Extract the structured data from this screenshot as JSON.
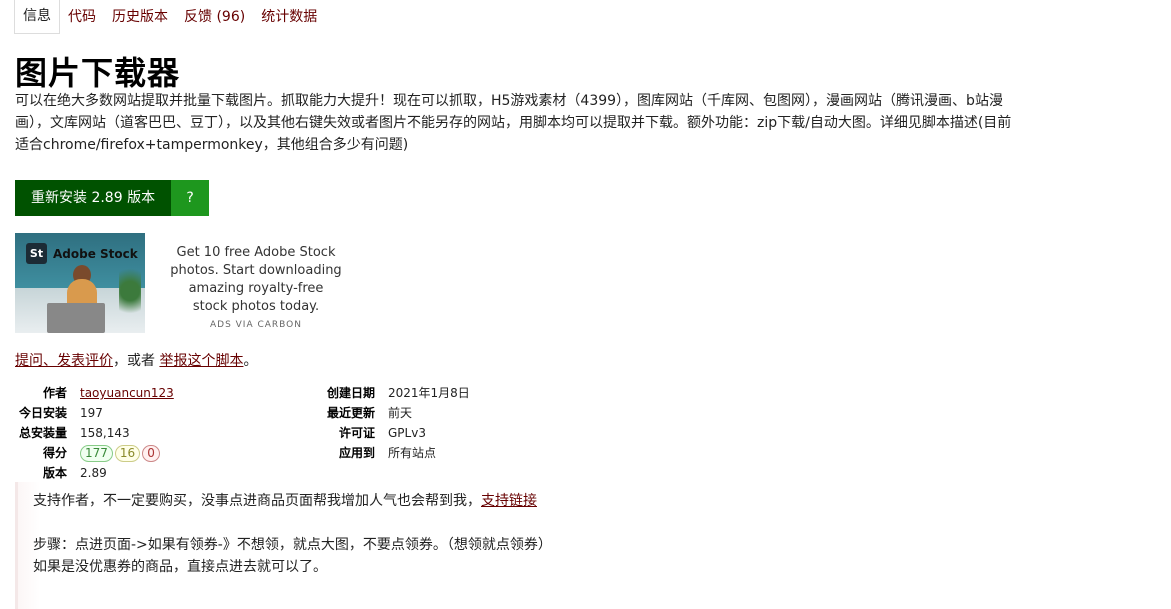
{
  "tabs": [
    "信息",
    "代码",
    "历史版本",
    "反馈 (96)",
    "统计数据"
  ],
  "title": "图片下载器",
  "description_lines": [
    "可以在绝大多数网站提取并批量下载图片。抓取能力大提升！现在可以抓取，H5游戏素材（4399），图库网站（千库网、包图网），漫画网站（腾讯漫画、b站漫",
    "画），文库网站（道客巴巴、豆丁），以及其他右键失效或者图片不能另存的网站，用脚本均可以提取并下载。额外功能：zip下载/自动大图。详细见脚本描述(目前",
    "适合chrome/firefox+tampermonkey，其他组合多少有问题)"
  ],
  "install": {
    "label": "重新安装 2.89 版本",
    "help": "?"
  },
  "ad": {
    "logo_mark": "St",
    "brand": "Adobe Stock",
    "text": "Get 10 free Adobe Stock photos. Start downloading amazing royalty-free stock photos today.",
    "via": "ADS VIA CARBON"
  },
  "feedback": {
    "ask_link": "提问、发表评价",
    "middle": "，或者 ",
    "report_link": "举报这个脚本",
    "end": "。"
  },
  "meta_left": {
    "author_label": "作者",
    "author": "taoyuancun123",
    "daily_label": "今日安装",
    "daily": "197",
    "total_label": "总安装量",
    "total": "158,143",
    "rating_label": "得分",
    "rating_good": "177",
    "rating_ok": "16",
    "rating_bad": "0",
    "version_label": "版本",
    "version": "2.89"
  },
  "meta_right": {
    "created_label": "创建日期",
    "created": "2021年1月8日",
    "updated_label": "最近更新",
    "updated": "前天",
    "license_label": "许可证",
    "license": "GPLv3",
    "applies_label": "应用到",
    "applies": "所有站点"
  },
  "additional": {
    "support_text": "支持作者，不一定要购买，没事点进商品页面帮我增加人气也会帮到我，",
    "support_link": "支持链接",
    "steps": "步骤：点进页面->如果有领券-》不想领，就点大图，不要点领券。（想领就点领券）",
    "note": "如果是没优惠券的商品，直接点进去就可以了。"
  },
  "colors": {
    "link": "#670000",
    "install": "#005200",
    "help": "#1e971e"
  }
}
